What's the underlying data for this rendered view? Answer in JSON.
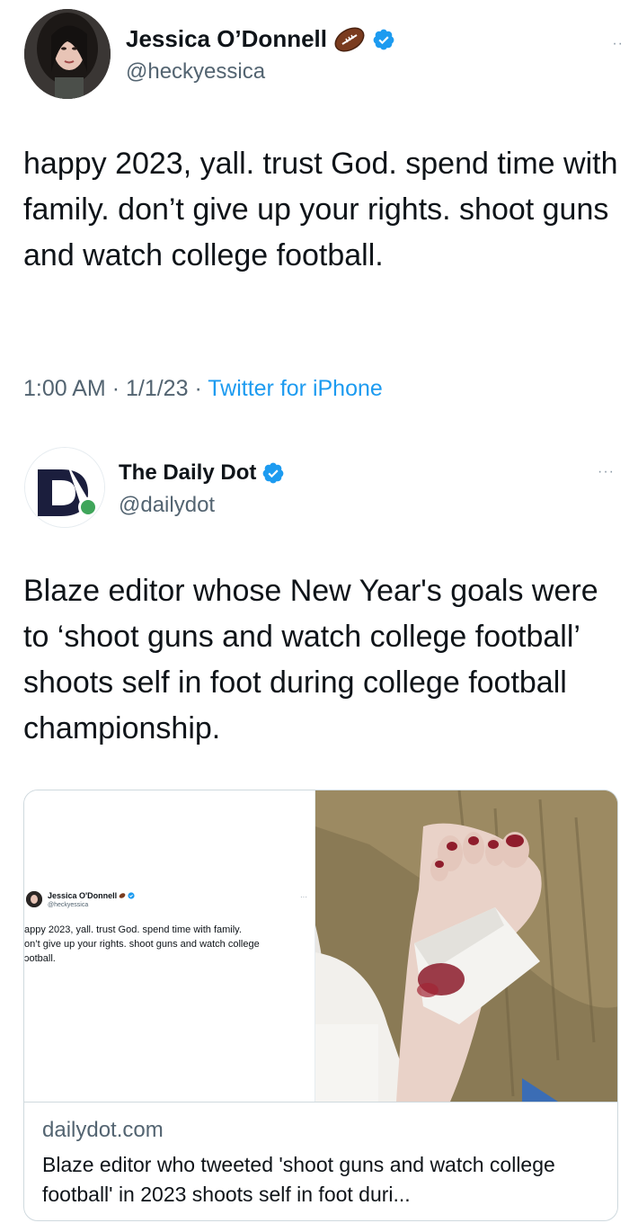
{
  "tweet1": {
    "display_name": "Jessica O’Donnell",
    "handle": "@heckyessica",
    "name_emoji_icon": "american-football-icon",
    "verified_icon": "verified-badge-icon",
    "more_icon": "more-dots-icon",
    "text": "happy 2023, yall. trust God. spend time with family. don’t give up your rights. shoot guns and watch college football.",
    "time": "1:00 AM",
    "date": "1/1/23",
    "source": "Twitter for iPhone"
  },
  "tweet2": {
    "display_name": "The Daily Dot",
    "handle": "@dailydot",
    "verified_icon": "verified-badge-icon",
    "more_icon": "more-dots-icon",
    "text": "Blaze editor whose New Year's goals were to ‘shoot guns and watch college football’ shoots self in foot during college football championship.",
    "card": {
      "domain": "dailydot.com",
      "title": "Blaze editor who tweeted 'shoot guns and watch college football' in 2023 shoots self in foot duri...",
      "embedded_tweet": {
        "display_name": "Jessica O'Donnell",
        "handle": "@heckyessica",
        "text": "appy 2023, yall. trust God. spend time with family.\non’t give up your rights. shoot guns and watch college\nɔotball."
      }
    }
  },
  "colors": {
    "text": "#0f1419",
    "secondary": "#536471",
    "link": "#1d9bf0",
    "verified": "#1d9bf0",
    "border": "#cfd9de",
    "daily_dot_navy": "#1b1e3d",
    "daily_dot_green": "#3fa55a"
  }
}
